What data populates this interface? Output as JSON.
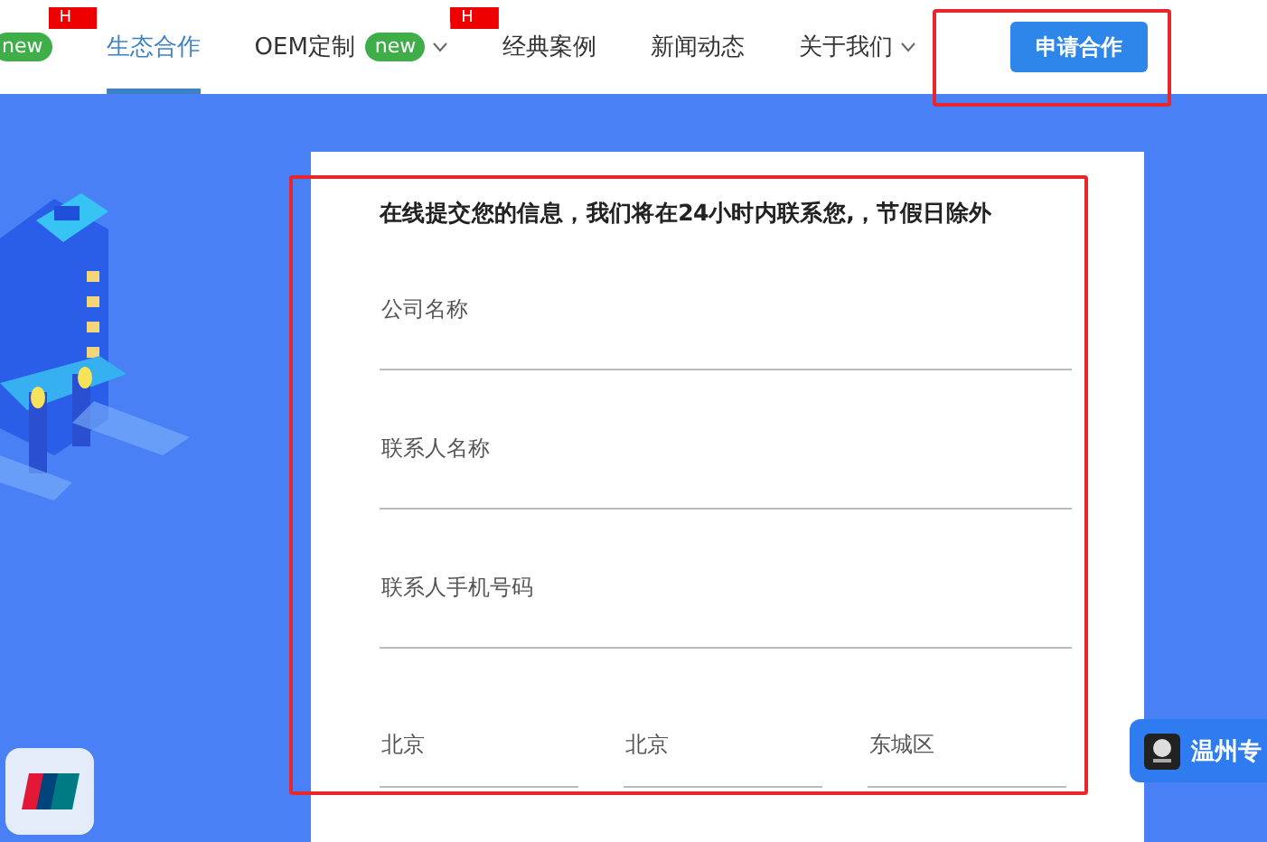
{
  "nav": {
    "items": [
      {
        "kind": "badge",
        "text": "new",
        "flag": "H"
      },
      {
        "kind": "link",
        "label": "生态合作",
        "selected": true
      },
      {
        "kind": "link",
        "label": "OEM定制",
        "selected": false,
        "badge": "new",
        "dropdown": true,
        "flag": "H"
      },
      {
        "kind": "link",
        "label": "经典案例",
        "selected": false
      },
      {
        "kind": "link",
        "label": "新闻动态",
        "selected": false
      },
      {
        "kind": "link",
        "label": "关于我们",
        "selected": false,
        "dropdown": true
      }
    ],
    "cta": "申请合作"
  },
  "form": {
    "title": "在线提交您的信息，我们将在24小时内联系您,，节假日除外",
    "fields": [
      {
        "kind": "text",
        "placeholder": "公司名称"
      },
      {
        "kind": "text",
        "placeholder": "联系人名称"
      },
      {
        "kind": "text",
        "placeholder": "联系人手机号码"
      },
      {
        "kind": "selects",
        "values": [
          "北京",
          "北京",
          "东城区"
        ]
      }
    ]
  },
  "widget": {
    "label": "温州专"
  },
  "annotations": [
    {
      "kind": "frame"
    },
    {
      "kind": "frame"
    }
  ]
}
